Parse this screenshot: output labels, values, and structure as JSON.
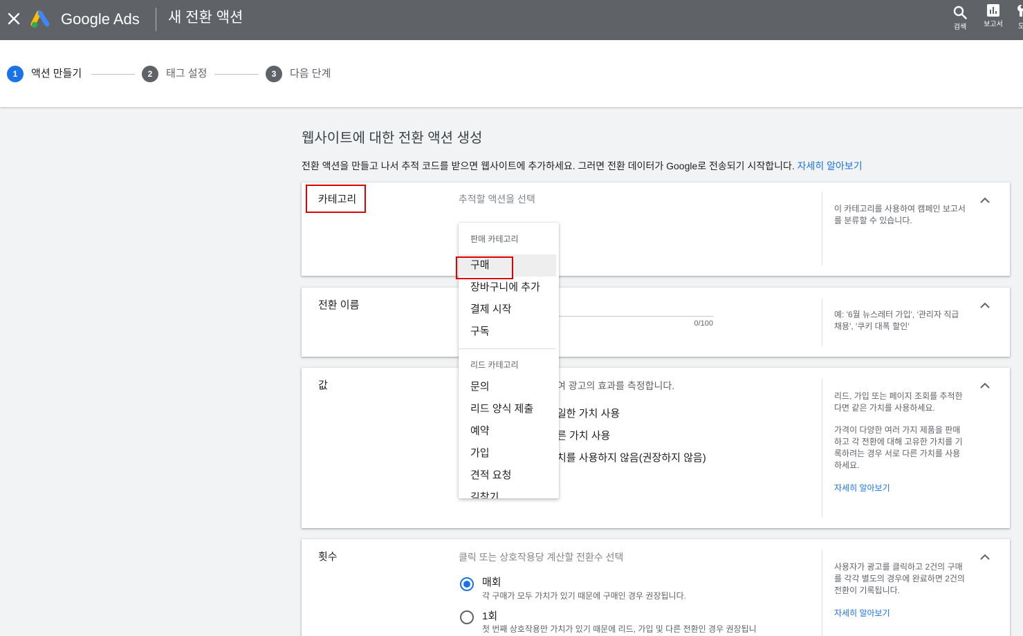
{
  "topbar": {
    "close_icon": "close-icon",
    "logo_icon": "google-ads-logo",
    "brand": "Google Ads",
    "page_title": "새 전환 액션",
    "actions": [
      {
        "icon": "search-icon",
        "label": "검색"
      },
      {
        "icon": "reports-icon",
        "label": "보고서"
      },
      {
        "icon": "tools-icon",
        "label": "도"
      }
    ],
    "background_color": "#5f6368"
  },
  "stepper": {
    "steps": [
      {
        "number": "1",
        "label": "액션 만들기",
        "active": true
      },
      {
        "number": "2",
        "label": "태그 설정",
        "active": false
      },
      {
        "number": "3",
        "label": "다음 단계",
        "active": false
      }
    ],
    "active_color": "#1a73e8",
    "inactive_color": "#5f6368"
  },
  "main": {
    "heading": "웹사이트에 대한 전환 액션 생성",
    "intro": "전환 액션을 만들고 나서 추적 코드를 받으면 웹사이트에 추가하세요. 그러면 전환 데이터가 Google로 전송되기 시작합니다.",
    "intro_link": "자세히 알아보기",
    "link_color": "#1a73e8",
    "sections": {
      "category": {
        "title": "카테고리",
        "placeholder": "추적할 액션을 선택",
        "help": "이 카테고리를 사용하여 캠페인 보고서를 분류할 수 있습니다.",
        "expanded": true
      },
      "conversion_name": {
        "title": "전환 이름",
        "counter": "0/100",
        "help": "예: '6월 뉴스레터 가입', '관리자 직급 채용', '쿠키 대폭 할인'",
        "expanded": true
      },
      "value_section": {
        "title": "값",
        "description_fragment": "여 광고의 효과를 측정합니다.",
        "option_fragments": [
          "일한 가치 사용",
          "른 가치 사용",
          "치를 사용하지 않음(권장하지 않음)"
        ],
        "help": [
          "리드, 가입 또는 페이지 조회를 추적한다면 같은 가치를 사용하세요.",
          "가격이 다양한 여러 가지 제품을 판매하고 각 전환에 대해 고유한 가치를 기록하려는 경우 서로 다른 가치를 사용하세요."
        ],
        "help_link": "자세히 알아보기",
        "expanded": true
      },
      "count_section": {
        "title": "횟수",
        "description": "클릭 또는 상호작용당 계산할 전환수 선택",
        "options": [
          {
            "label": "매회",
            "desc": "각 구매가 모두 가치가 있기 때문에 구매인 경우 권장됩니다.",
            "selected": true
          },
          {
            "label": "1회",
            "desc": "첫 번째 상호작용만 가치가 있기 때문에 리드, 가입 및 다른 전환인 경우 권장됩니",
            "selected": false
          }
        ],
        "help": "사용자가 광고를 클릭하고 2건의 구매를 각각 별도의 경우에 완료하면 2건의 전환이 기록됩니다.",
        "help_link": "자세히 알아보기",
        "expanded": true
      }
    }
  },
  "category_dropdown": {
    "groups": [
      {
        "heading": "판매 카테고리",
        "items": [
          "구매",
          "장바구니에 추가",
          "결제 시작",
          "구독"
        ]
      },
      {
        "heading": "리드 카테고리",
        "items": [
          "문의",
          "리드 양식 제출",
          "예약",
          "가입",
          "견적 요청",
          "길찾기"
        ]
      }
    ],
    "highlighted_item": "구매"
  },
  "annotation_color": "#e00000"
}
